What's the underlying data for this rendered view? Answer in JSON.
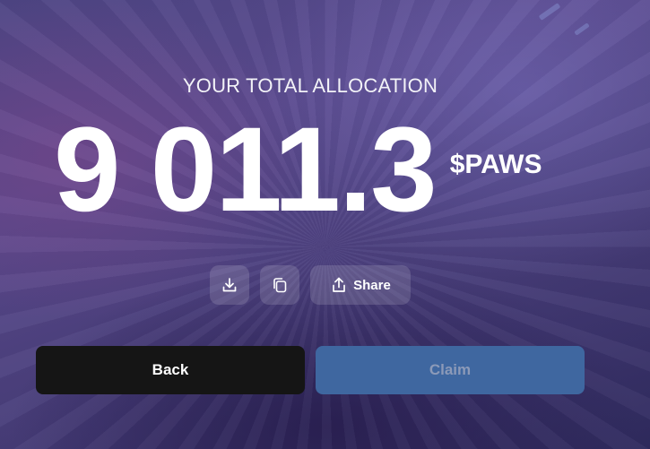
{
  "allocation": {
    "label": "YOUR TOTAL ALLOCATION",
    "amount": "9 011.3",
    "ticker": "$PAWS"
  },
  "actions": {
    "download_icon": "download-icon",
    "copy_icon": "copy-icon",
    "share_label": "Share",
    "share_icon": "share-icon"
  },
  "buttons": {
    "back_label": "Back",
    "claim_label": "Claim"
  },
  "colors": {
    "back_bg": "#151515",
    "claim_bg": "#3f67a0",
    "claim_text": "#8c9ab8",
    "icon_button_bg": "rgba(255,255,255,0.14)"
  }
}
